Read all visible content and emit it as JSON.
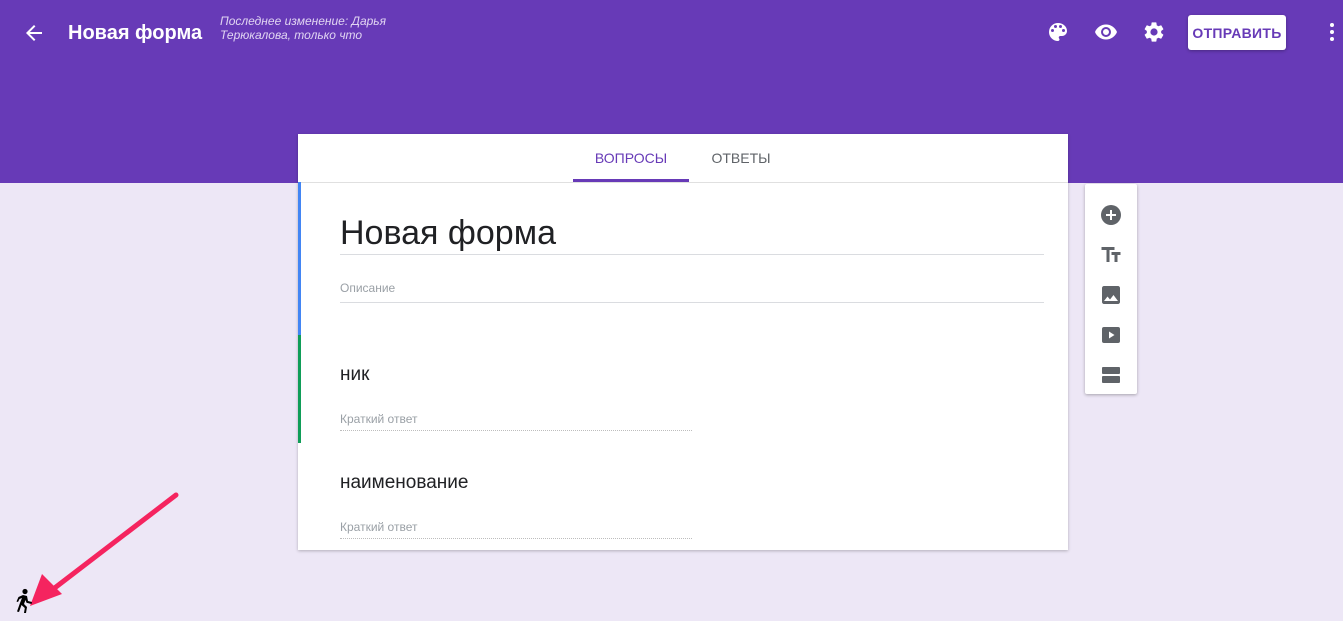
{
  "header": {
    "title": "Новая форма",
    "last_edit": "Последнее изменение: Дарья Терюкалова, только что",
    "send_label": "ОТПРАВИТЬ",
    "icons": [
      "back-arrow-icon",
      "palette-icon",
      "eye-icon",
      "gear-icon",
      "more-vert-icon"
    ],
    "color": "#673ab7"
  },
  "tabs": [
    {
      "label": "ВОПРОСЫ",
      "active": true
    },
    {
      "label": "ОТВЕТЫ",
      "active": false
    }
  ],
  "form": {
    "title": "Новая форма",
    "description_placeholder": "Описание"
  },
  "questions": [
    {
      "title": "ник",
      "answer_placeholder": "Краткий ответ"
    },
    {
      "title": "наименование",
      "answer_placeholder": "Краткий ответ"
    }
  ],
  "toolbar": {
    "icons": [
      "add-circle-icon",
      "text-title-icon",
      "image-icon",
      "video-icon",
      "section-icon"
    ]
  },
  "colors": {
    "accent": "#673ab7",
    "background": "#ede7f6",
    "title_bar": "#4285f4",
    "question_bar": "#0f9d58",
    "annotation_arrow": "#f5245f"
  }
}
